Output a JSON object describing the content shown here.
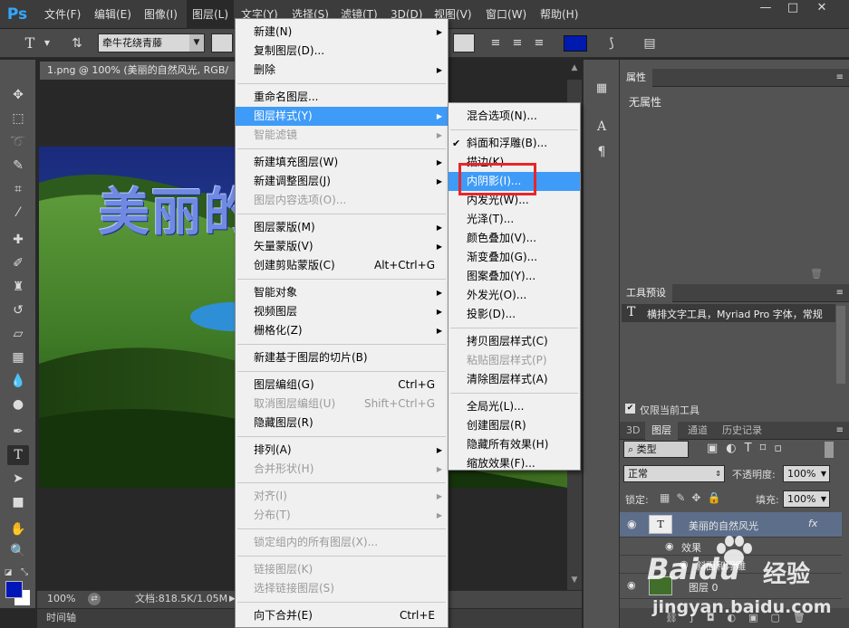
{
  "app": {
    "logo": "Ps"
  },
  "menubar": {
    "items": [
      "文件(F)",
      "编辑(E)",
      "图像(I)",
      "图层(L)",
      "文字(Y)",
      "选择(S)",
      "滤镜(T)",
      "3D(D)",
      "视图(V)",
      "窗口(W)",
      "帮助(H)"
    ],
    "window_controls": [
      "—",
      "□",
      "✕"
    ]
  },
  "options_bar": {
    "tool_glyph": "T",
    "font_family": "牵牛花绕青藤"
  },
  "document": {
    "tab_title": "1.png @ 100% (美丽的自然风光, RGB/",
    "canvas_text": "美丽的",
    "zoom": "100%",
    "doc_info": "文档:818.5K/1.05M"
  },
  "timeline": {
    "label": "时间轴"
  },
  "layer_menu": {
    "groups": [
      [
        {
          "label": "新建(N)",
          "arrow": true
        },
        {
          "label": "复制图层(D)..."
        },
        {
          "label": "删除",
          "arrow": true
        }
      ],
      [
        {
          "label": "重命名图层..."
        },
        {
          "label": "图层样式(Y)",
          "arrow": true,
          "highlight": true
        },
        {
          "label": "智能滤镜",
          "arrow": true,
          "disabled": true
        }
      ],
      [
        {
          "label": "新建填充图层(W)",
          "arrow": true
        },
        {
          "label": "新建调整图层(J)",
          "arrow": true
        },
        {
          "label": "图层内容选项(O)...",
          "disabled": true
        }
      ],
      [
        {
          "label": "图层蒙版(M)",
          "arrow": true
        },
        {
          "label": "矢量蒙版(V)",
          "arrow": true
        },
        {
          "label": "创建剪贴蒙版(C)",
          "shortcut": "Alt+Ctrl+G"
        }
      ],
      [
        {
          "label": "智能对象",
          "arrow": true
        },
        {
          "label": "视频图层",
          "arrow": true
        },
        {
          "label": "栅格化(Z)",
          "arrow": true
        }
      ],
      [
        {
          "label": "新建基于图层的切片(B)"
        }
      ],
      [
        {
          "label": "图层编组(G)",
          "shortcut": "Ctrl+G"
        },
        {
          "label": "取消图层编组(U)",
          "shortcut": "Shift+Ctrl+G",
          "disabled": true
        },
        {
          "label": "隐藏图层(R)"
        }
      ],
      [
        {
          "label": "排列(A)",
          "arrow": true
        },
        {
          "label": "合并形状(H)",
          "arrow": true,
          "disabled": true
        }
      ],
      [
        {
          "label": "对齐(I)",
          "arrow": true,
          "disabled": true
        },
        {
          "label": "分布(T)",
          "arrow": true,
          "disabled": true
        }
      ],
      [
        {
          "label": "锁定组内的所有图层(X)...",
          "disabled": true
        }
      ],
      [
        {
          "label": "链接图层(K)",
          "disabled": true
        },
        {
          "label": "选择链接图层(S)",
          "disabled": true
        }
      ],
      [
        {
          "label": "向下合并(E)",
          "shortcut": "Ctrl+E"
        }
      ]
    ]
  },
  "style_submenu": {
    "groups": [
      [
        {
          "label": "混合选项(N)..."
        }
      ],
      [
        {
          "label": "斜面和浮雕(B)...",
          "checked": true
        },
        {
          "label": "描边(K)..."
        },
        {
          "label": "内阴影(I)...",
          "highlight": true
        },
        {
          "label": "内发光(W)..."
        },
        {
          "label": "光泽(T)..."
        },
        {
          "label": "颜色叠加(V)..."
        },
        {
          "label": "渐变叠加(G)..."
        },
        {
          "label": "图案叠加(Y)..."
        },
        {
          "label": "外发光(O)..."
        },
        {
          "label": "投影(D)..."
        }
      ],
      [
        {
          "label": "拷贝图层样式(C)"
        },
        {
          "label": "粘贴图层样式(P)",
          "disabled": true
        },
        {
          "label": "清除图层样式(A)"
        }
      ],
      [
        {
          "label": "全局光(L)..."
        },
        {
          "label": "创建图层(R)"
        },
        {
          "label": "隐藏所有效果(H)"
        },
        {
          "label": "缩放效果(F)..."
        }
      ]
    ]
  },
  "properties_panel": {
    "title": "属性",
    "content": "无属性"
  },
  "tool_presets_panel": {
    "title": "工具预设",
    "preset": "横排文字工具，Myriad Pro 字体，常规",
    "only_current_label": "仅限当前工具"
  },
  "layers_panel": {
    "tabs": [
      "3D",
      "图层",
      "通道",
      "历史记录"
    ],
    "filter_kind": "类型",
    "blend_mode": "正常",
    "opacity_label": "不透明度:",
    "opacity_value": "100%",
    "lock_label": "锁定:",
    "fill_label": "填充:",
    "fill_value": "100%",
    "layers": [
      {
        "name": "美丽的自然风光",
        "fx": "fx",
        "effects_label": "效果",
        "effect_item": "斜面和浮雕"
      },
      {
        "name": "图层 0"
      }
    ],
    "bottom_icons": [
      "link-icon",
      "fx-icon",
      "mask-icon",
      "adjustment-icon",
      "folder-icon",
      "new-layer-icon",
      "trash-icon"
    ]
  },
  "watermark": {
    "brand": "Baidu",
    "suffix": "经验",
    "url": "jingyan.baidu.com"
  },
  "colors": {
    "accent": "#3f9bf8",
    "highlight_box": "#e7262a",
    "foreground": "#0016b8"
  }
}
